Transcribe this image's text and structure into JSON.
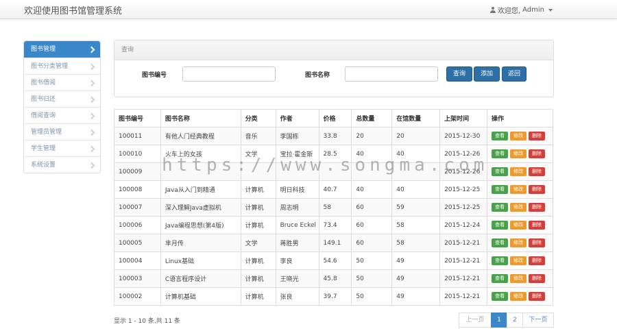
{
  "header": {
    "title": "欢迎使用图书馆管理系统",
    "welcome": "欢迎您,",
    "username": "Admin"
  },
  "sidebar": {
    "items": [
      {
        "label": "图书管理",
        "active": true
      },
      {
        "label": "图书分类管理"
      },
      {
        "label": "图书借阅"
      },
      {
        "label": "图书归还"
      },
      {
        "label": "借阅查询"
      },
      {
        "label": "管理员管理"
      },
      {
        "label": "学生管理"
      },
      {
        "label": "系统设置"
      }
    ]
  },
  "query": {
    "title": "查询",
    "book_id_label": "图书编号",
    "book_name_label": "图书名称",
    "book_id_value": "",
    "book_name_value": "",
    "search_label": "查询",
    "add_label": "添加",
    "back_label": "返回"
  },
  "table": {
    "headers": [
      "图书编号",
      "图书名称",
      "分类",
      "作者",
      "价格",
      "总数量",
      "在馆数量",
      "上架时间",
      "操作"
    ],
    "rows": [
      [
        "100011",
        "有他人门经典教程",
        "音乐",
        "李国栋",
        "33.8",
        "20",
        "20",
        "2015-12-30"
      ],
      [
        "100010",
        "火车上的女孩",
        "文学",
        "宝拉·霍金斯",
        "28.5",
        "40",
        "40",
        "2015-12-26"
      ],
      [
        "100009",
        "",
        "",
        "",
        "",
        "",
        "",
        "2015-12-26"
      ],
      [
        "100008",
        "Java从入门到精通",
        "计算机",
        "明日科技",
        "40.7",
        "40",
        "40",
        "2015-12-25"
      ],
      [
        "100007",
        "深入理解Java虚拟机",
        "计算机",
        "周志明",
        "58",
        "60",
        "59",
        "2015-12-25"
      ],
      [
        "100006",
        "Java编程思想(第4版)",
        "计算机",
        "Bruce Eckel",
        "73.4",
        "60",
        "58",
        "2015-12-24"
      ],
      [
        "100005",
        "芈月传",
        "文学",
        "蒋胜男",
        "149.1",
        "60",
        "58",
        "2015-12-21"
      ],
      [
        "100004",
        "Linux基础",
        "计算机",
        "李良",
        "54.6",
        "50",
        "49",
        "2015-12-21"
      ],
      [
        "100003",
        "C语言程序设计",
        "计算机",
        "王晓光",
        "45.8",
        "50",
        "49",
        "2015-12-21"
      ],
      [
        "100002",
        "计算机基础",
        "计算机",
        "张良",
        "39.7",
        "50",
        "49",
        "2015-12-21"
      ]
    ],
    "view_label": "查看",
    "edit_label": "修改",
    "delete_label": "删除"
  },
  "pagination": {
    "info": "显示 1 - 10 条,共 11 条",
    "prev_label": "上一页",
    "pages": [
      "1",
      "2"
    ],
    "current": "1",
    "next_label": "下一页"
  },
  "watermark": "https://www.songma.com"
}
